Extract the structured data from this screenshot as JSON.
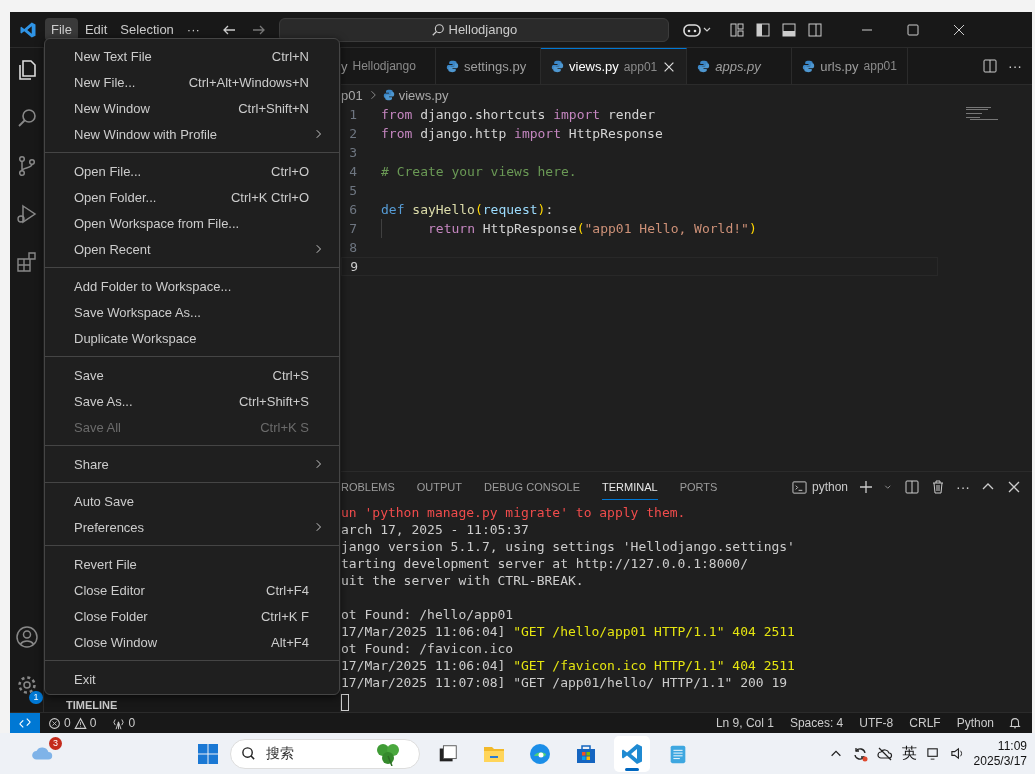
{
  "title_bar": {
    "menus": [
      {
        "label": "File",
        "selected": true
      },
      {
        "label": "Edit",
        "selected": false
      },
      {
        "label": "Selection",
        "selected": false
      }
    ],
    "more": "···",
    "command_center": "Hellodjango"
  },
  "file_menu": {
    "groups": [
      {
        "items": [
          {
            "label": "New Text File",
            "shortcut": "Ctrl+N",
            "submenu": false,
            "disabled": false
          },
          {
            "label": "New File...",
            "shortcut": "Ctrl+Alt+Windows+N",
            "submenu": false,
            "disabled": false
          },
          {
            "label": "New Window",
            "shortcut": "Ctrl+Shift+N",
            "submenu": false,
            "disabled": false
          },
          {
            "label": "New Window with Profile",
            "submenu": true,
            "disabled": false
          }
        ]
      },
      {
        "items": [
          {
            "label": "Open File...",
            "shortcut": "Ctrl+O",
            "submenu": false,
            "disabled": false
          },
          {
            "label": "Open Folder...",
            "shortcut": "Ctrl+K Ctrl+O",
            "submenu": false,
            "disabled": false
          },
          {
            "label": "Open Workspace from File...",
            "submenu": false,
            "disabled": false
          },
          {
            "label": "Open Recent",
            "submenu": true,
            "disabled": false
          }
        ]
      },
      {
        "items": [
          {
            "label": "Add Folder to Workspace...",
            "submenu": false,
            "disabled": false
          },
          {
            "label": "Save Workspace As...",
            "submenu": false,
            "disabled": false
          },
          {
            "label": "Duplicate Workspace",
            "submenu": false,
            "disabled": false
          }
        ]
      },
      {
        "items": [
          {
            "label": "Save",
            "shortcut": "Ctrl+S",
            "submenu": false,
            "disabled": false
          },
          {
            "label": "Save As...",
            "shortcut": "Ctrl+Shift+S",
            "submenu": false,
            "disabled": false
          },
          {
            "label": "Save All",
            "shortcut": "Ctrl+K S",
            "submenu": false,
            "disabled": true
          }
        ]
      },
      {
        "items": [
          {
            "label": "Share",
            "submenu": true,
            "disabled": false
          }
        ]
      },
      {
        "items": [
          {
            "label": "Auto Save",
            "submenu": false,
            "disabled": false
          },
          {
            "label": "Preferences",
            "submenu": true,
            "disabled": false
          }
        ]
      },
      {
        "items": [
          {
            "label": "Revert File",
            "submenu": false,
            "disabled": false
          },
          {
            "label": "Close Editor",
            "shortcut": "Ctrl+F4",
            "submenu": false,
            "disabled": false
          },
          {
            "label": "Close Folder",
            "shortcut": "Ctrl+K F",
            "submenu": false,
            "disabled": false
          },
          {
            "label": "Close Window",
            "shortcut": "Alt+F4",
            "submenu": false,
            "disabled": false
          }
        ]
      },
      {
        "items": [
          {
            "label": "Exit",
            "submenu": false,
            "disabled": false
          }
        ]
      }
    ]
  },
  "activity_bar": {
    "settings_badge": "1"
  },
  "sidebar": {
    "section": "TIMELINE"
  },
  "tabs": [
    {
      "name": "y",
      "description": "Hellodjango",
      "selected": false,
      "preview": false
    },
    {
      "name": "settings.py",
      "selected": false,
      "preview": false
    },
    {
      "name": "views.py",
      "description": "app01",
      "selected": true,
      "preview": false
    },
    {
      "name": "apps.py",
      "selected": false,
      "preview": true
    },
    {
      "name": "urls.py",
      "description": "app01",
      "selected": false,
      "preview": false
    }
  ],
  "editor_more": "···",
  "breadcrumb": [
    "p01",
    "views.py"
  ],
  "code": [
    {
      "number": "1",
      "current": false,
      "indent": false,
      "tokens": [
        {
          "t": "from",
          "kind": "keyword"
        },
        {
          "t": " django.shortcuts ",
          "kind": "plain"
        },
        {
          "t": "import",
          "kind": "keyword"
        },
        {
          "t": " render",
          "kind": "plain"
        }
      ]
    },
    {
      "number": "2",
      "current": false,
      "indent": false,
      "tokens": [
        {
          "t": "from",
          "kind": "keyword"
        },
        {
          "t": " django.http ",
          "kind": "plain"
        },
        {
          "t": "import",
          "kind": "keyword"
        },
        {
          "t": " HttpResponse",
          "kind": "plain"
        }
      ]
    },
    {
      "number": "3",
      "current": false,
      "indent": false
    },
    {
      "number": "4",
      "current": false,
      "indent": false,
      "tokens": [
        {
          "t": "# Create your views here.",
          "kind": "comment"
        }
      ]
    },
    {
      "number": "5",
      "current": false,
      "indent": false
    },
    {
      "number": "6",
      "current": false,
      "indent": false,
      "tokens": [
        {
          "t": "def ",
          "kind": "storage"
        },
        {
          "t": "sayHello",
          "kind": "function"
        },
        {
          "t": "(",
          "kind": "bracket"
        },
        {
          "t": "request",
          "kind": "param"
        },
        {
          "t": ")",
          "kind": "bracket"
        },
        {
          "t": ":",
          "kind": "plain"
        }
      ]
    },
    {
      "number": "7",
      "current": false,
      "indent": true,
      "tokens": [
        {
          "t": "return",
          "kind": "keyword"
        },
        {
          "t": " HttpResponse",
          "kind": "plain"
        },
        {
          "t": "(",
          "kind": "bracket"
        },
        {
          "t": "\"app01 Hello, World!\"",
          "kind": "string"
        },
        {
          "t": ")",
          "kind": "bracket"
        }
      ]
    },
    {
      "number": "8",
      "current": false,
      "indent": false
    },
    {
      "number": "9",
      "current": true,
      "indent": false
    }
  ],
  "panel": {
    "tabs": [
      {
        "label": "ROBLEMS",
        "selected": false
      },
      {
        "label": "OUTPUT",
        "selected": false
      },
      {
        "label": "DEBUG CONSOLE",
        "selected": false
      },
      {
        "label": "TERMINAL",
        "selected": true
      },
      {
        "label": "PORTS",
        "selected": false
      }
    ],
    "shell": "python",
    "more": "···",
    "lines": [
      {
        "kind": "text",
        "segments": [
          {
            "t": "un 'python manage.py migrate' to apply them.",
            "kind": "error"
          }
        ]
      },
      {
        "kind": "text",
        "segments": [
          {
            "t": "arch 17, 2025 - 11:05:37",
            "kind": "plain"
          }
        ]
      },
      {
        "kind": "text",
        "segments": [
          {
            "t": "jango version 5.1.7, using settings 'Hellodjango.settings'",
            "kind": "plain"
          }
        ]
      },
      {
        "kind": "text",
        "segments": [
          {
            "t": "tarting development server at http://127.0.0.1:8000/",
            "kind": "plain"
          }
        ]
      },
      {
        "kind": "text",
        "segments": [
          {
            "t": "uit the server with CTRL-BREAK.",
            "kind": "plain"
          }
        ]
      },
      {
        "kind": "blank"
      },
      {
        "kind": "text",
        "segments": [
          {
            "t": "ot Found: /hello/app01",
            "kind": "plain"
          }
        ]
      },
      {
        "kind": "text",
        "segments": [
          {
            "t": "17/Mar/2025 11:06:04] ",
            "kind": "plain"
          },
          {
            "t": "\"GET /hello/app01 HTTP/1.1\" 404 2511",
            "kind": "warning"
          }
        ]
      },
      {
        "kind": "text",
        "segments": [
          {
            "t": "ot Found: /favicon.ico",
            "kind": "plain"
          }
        ]
      },
      {
        "kind": "text",
        "segments": [
          {
            "t": "17/Mar/2025 11:06:04] ",
            "kind": "plain"
          },
          {
            "t": "\"GET /favicon.ico HTTP/1.1\" 404 2511",
            "kind": "warning"
          }
        ]
      },
      {
        "kind": "text",
        "segments": [
          {
            "t": "17/Mar/2025 11:07:08] \"GET /app01/hello/ HTTP/1.1\" 200 19",
            "kind": "plain"
          }
        ]
      }
    ]
  },
  "status_bar": {
    "errors": "0",
    "warnings": "0",
    "ports": "0",
    "right": [
      "Ln 9, Col 1",
      "Spaces: 4",
      "UTF-8",
      "CRLF",
      "Python"
    ]
  },
  "taskbar": {
    "weather_badge": "3",
    "search_placeholder": "搜索",
    "apps": [
      {
        "kind": "taskview",
        "selected": false
      },
      {
        "kind": "folder",
        "selected": false
      },
      {
        "kind": "edge",
        "selected": false
      },
      {
        "kind": "store",
        "selected": false
      },
      {
        "kind": "vscode",
        "selected": true
      },
      {
        "kind": "notepad",
        "selected": false
      }
    ],
    "ime": "英",
    "time": "11:09",
    "date": "2025/3/17"
  }
}
